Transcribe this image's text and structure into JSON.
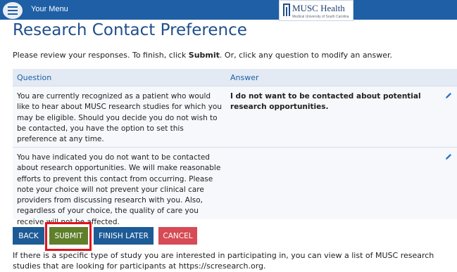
{
  "header": {
    "menu_label": "Your Menu",
    "logo_name": "MUSC Health",
    "logo_tagline": "Medical University of South Carolina"
  },
  "page": {
    "title": "Research Contact Preference",
    "intro_prefix": "Please review your responses. To finish, click ",
    "intro_bold": "Submit",
    "intro_suffix": ". Or, click any question to modify an answer."
  },
  "table": {
    "col_question": "Question",
    "col_answer": "Answer",
    "rows": [
      {
        "question": "You are currently recognized as a patient who would like to hear about MUSC research studies for which you may be eligible. Should you decide you do not wish to be contacted, you have the option to set this preference at any time.",
        "answer": "I do not want to be contacted about potential research opportunities."
      },
      {
        "question": "You have indicated you do not want to be contacted about research opportunities. We will make reasonable efforts to prevent this contact from occurring. Please note your choice will not prevent your clinical care providers from discussing research with you. Also, regardless of your choice, the quality of care you receive will not be affected.",
        "answer": ""
      }
    ]
  },
  "buttons": {
    "back": "BACK",
    "submit": "SUBMIT",
    "finish_later": "FINISH LATER",
    "cancel": "CANCEL"
  },
  "footnote": "If there is a specific type of study you are interested in participating in, you can view a list of MUSC research studies that are looking for participants at https://scresearch.org.",
  "colors": {
    "header_bg": "#1f5fa6",
    "title": "#1e4f8c",
    "back": "#1d5b97",
    "submit": "#5f7f2a",
    "cancel": "#d64b55",
    "highlight": "#e0141e"
  },
  "icons": [
    "hamburger-icon",
    "musc-logo",
    "pencil-edit-icon"
  ]
}
